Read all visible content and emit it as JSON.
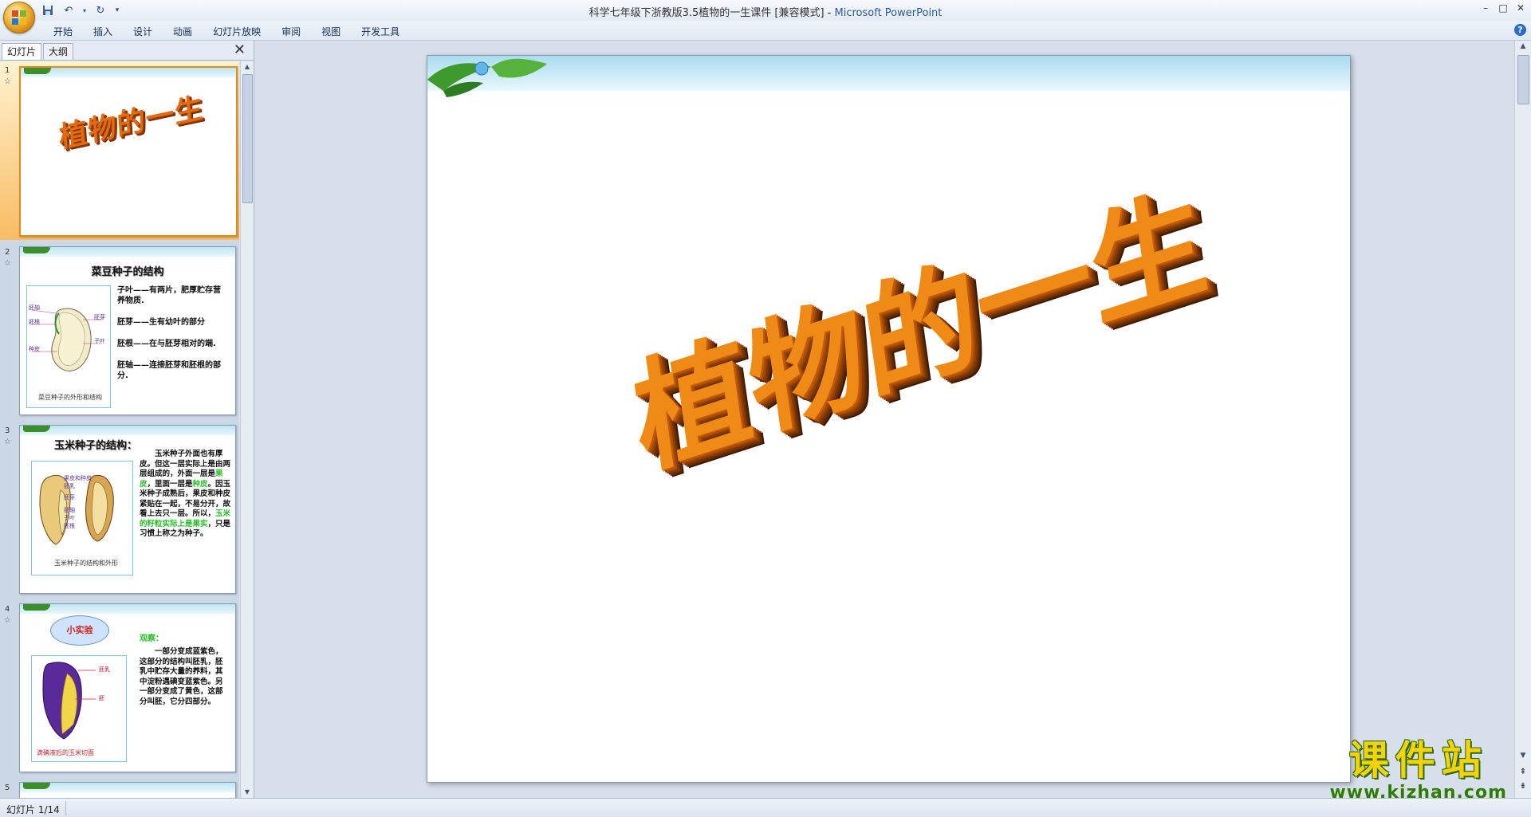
{
  "window": {
    "title_prefix": "科学七年级下浙教版3.5植物的一生课件 [兼容模式]",
    "title_sep": " - ",
    "app_name": "Microsoft PowerPoint",
    "controls": [
      "–",
      "□",
      "✕"
    ]
  },
  "quick_access": [
    {
      "name": "save-icon",
      "glyph": "💾"
    },
    {
      "name": "undo-icon",
      "glyph": "↶"
    },
    {
      "name": "redo-icon",
      "glyph": "↻"
    },
    {
      "name": "customize-icon",
      "glyph": "▾"
    }
  ],
  "ribbon": {
    "tabs": [
      "开始",
      "插入",
      "设计",
      "动画",
      "幻灯片放映",
      "审阅",
      "视图",
      "开发工具"
    ],
    "help": "?"
  },
  "left_pane": {
    "tabs": [
      "幻灯片",
      "大纲"
    ],
    "close": "✕"
  },
  "thumbnails": {
    "t1": {
      "num": "1",
      "title": "植物的一生"
    },
    "t2": {
      "num": "2",
      "heading": "菜豆种子的结构",
      "caption": "菜豆种子的外形和结构",
      "labels": [
        "胚轴",
        "胚根",
        "种皮",
        "胚芽",
        "子叶"
      ],
      "lines": [
        "子叶——有两片，肥厚贮存营养物质.",
        "胚芽——生有幼叶的部分",
        "胚根——在与胚芽相对的端.",
        "胚轴——连接胚芽和胚根的部分."
      ]
    },
    "t3": {
      "num": "3",
      "heading": "玉米种子的结构：",
      "caption": "玉米种子的结构和外形",
      "labels": [
        "果皮和种皮",
        "胚乳",
        "胚芽",
        "胚轴",
        "子叶",
        "胚根"
      ],
      "text_a": "玉米种子外面也有厚皮。但这一层实际上是由两层组成的，外面一层是",
      "text_b": "果皮",
      "text_c": "，里面一层是",
      "text_d": "种皮",
      "text_e": "。因玉米种子成熟后，果皮和种皮紧贴在一起，不易分开，故看上去只一层。所以，",
      "text_f": "玉米的籽粒实际上是果实",
      "text_g": "，只是习惯上称之为种子。"
    },
    "t4": {
      "num": "4",
      "badge": "小实验",
      "observe": "观察：",
      "body": "一部分变成蓝紫色， 这部分的结构叫胚乳，胚乳中贮存大量的养料，其中淀粉遇碘变蓝紫色。另一部分变成了黄色，这部分叫胚，它分四部分。",
      "labels": [
        "胚乳",
        "胚"
      ],
      "caption": "滴碘液后的玉米切面"
    },
    "t5": {
      "num": "5"
    }
  },
  "slide": {
    "title": "植物的一生"
  },
  "watermark": {
    "cn": "课件站",
    "url": "www.kjzhan.com"
  },
  "status": {
    "slide_info": "幻灯片 1/14"
  },
  "colors": {
    "title_orange": "#f08a16",
    "title_shadow": "#8c3e07",
    "selected_thumb": "#f8bc63",
    "accent_green": "#2bbf2b"
  }
}
